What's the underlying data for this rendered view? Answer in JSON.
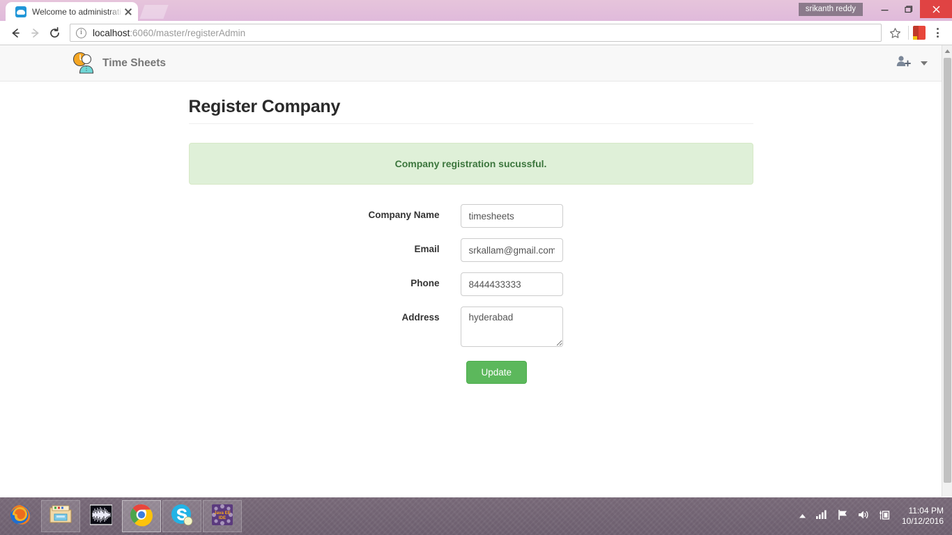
{
  "browser": {
    "tab": {
      "title": "Welcome to administrati",
      "favicon_icon": "cloud-icon",
      "close_icon": "close-icon"
    },
    "new_tab_label": "",
    "window": {
      "user_label": "srikanth reddy",
      "minimize_icon": "minimize-icon",
      "maximize_icon": "maximize-icon",
      "close_icon": "close-icon"
    },
    "toolbar": {
      "back_icon": "back-arrow-icon",
      "forward_icon": "forward-arrow-icon",
      "reload_icon": "reload-icon",
      "site_info_icon": "info-icon",
      "url_host": "localhost",
      "url_rest": ":6060/master/registerAdmin",
      "url_full": "localhost:6060/master/registerAdmin",
      "bookmark_icon": "star-icon",
      "extension_icon": "extension-icon",
      "menu_icon": "kebab-menu-icon"
    }
  },
  "app": {
    "navbar": {
      "brand_label": "Time Sheets",
      "brand_logo_icon": "timesheets-logo-icon",
      "user_add_icon": "user-add-icon",
      "caret_icon": "chevron-down-icon"
    },
    "page_title": "Register Company",
    "alert": {
      "type": "success",
      "message": "Company registration sucussful.",
      "bg_color": "#dff0d8",
      "text_color": "#3c763d",
      "border_color": "#d6e9c6"
    },
    "form": {
      "fields": [
        {
          "name": "company-name",
          "label": "Company Name",
          "value": "timesheets",
          "type": "text",
          "placeholder": ""
        },
        {
          "name": "email",
          "label": "Email",
          "value": "srkallam@gmail.com",
          "type": "text",
          "placeholder": ""
        },
        {
          "name": "phone",
          "label": "Phone",
          "value": "8444433333",
          "type": "text",
          "placeholder": ""
        },
        {
          "name": "address",
          "label": "Address",
          "value": "hyderabad",
          "type": "textarea",
          "placeholder": ""
        }
      ],
      "submit_label": "Update",
      "submit_color": "#5cb85c"
    },
    "scrollbar": {
      "up_arrow_icon": "scroll-up-arrow-icon"
    }
  },
  "taskbar": {
    "items": [
      {
        "name": "firefox",
        "icon": "firefox-icon",
        "state": "normal"
      },
      {
        "name": "file-explorer",
        "icon": "folder-icon",
        "state": "framed"
      },
      {
        "name": "audio-editor",
        "icon": "waveform-icon",
        "state": "normal"
      },
      {
        "name": "chrome",
        "icon": "chrome-icon",
        "state": "active"
      },
      {
        "name": "skype",
        "icon": "skype-icon",
        "state": "framed"
      },
      {
        "name": "java-ee-ide",
        "icon": "eclipse-icon",
        "state": "framed"
      }
    ],
    "tray": {
      "show_hidden_icon": "chevron-up-icon",
      "network_icon": "signal-bars-icon",
      "action_center_icon": "flag-icon",
      "volume_icon": "speaker-icon",
      "battery_icon": "battery-icon",
      "time": "11:04 PM",
      "date": "10/12/2016"
    }
  }
}
